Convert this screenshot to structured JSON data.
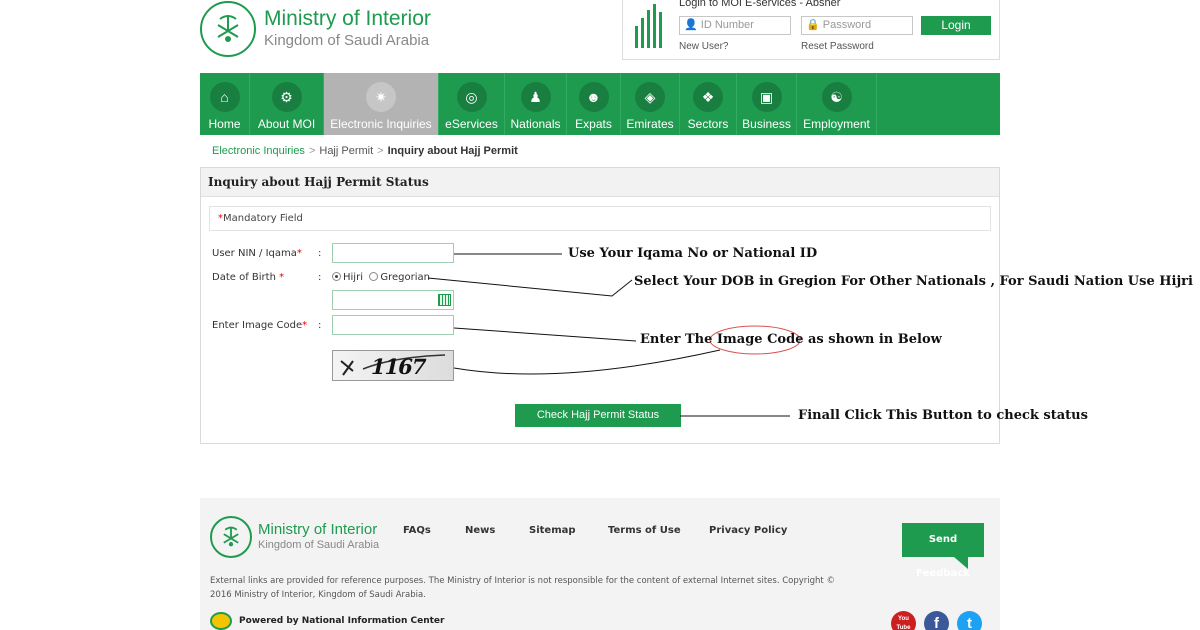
{
  "header": {
    "logo_title": "Ministry of Interior",
    "logo_subtitle": "Kingdom of Saudi Arabia"
  },
  "login": {
    "title": "Login to MOI E-services - Absher",
    "id_placeholder": "ID Number",
    "password_placeholder": "Password",
    "button": "Login",
    "new_user": "New User?",
    "reset_password": "Reset Password"
  },
  "nav": {
    "items": [
      {
        "label": "Home",
        "icon": "home-icon"
      },
      {
        "label": "About MOI",
        "icon": "emblem-icon"
      },
      {
        "label": "Electronic Inquiries",
        "icon": "fingerprint-icon",
        "active": true
      },
      {
        "label": "eServices",
        "icon": "globe-icon"
      },
      {
        "label": "Nationals",
        "icon": "person-icon"
      },
      {
        "label": "Expats",
        "icon": "group-icon"
      },
      {
        "label": "Emirates",
        "icon": "map-icon"
      },
      {
        "label": "Sectors",
        "icon": "network-icon"
      },
      {
        "label": "Business",
        "icon": "briefcase-icon"
      },
      {
        "label": "Employment",
        "icon": "team-icon"
      }
    ]
  },
  "breadcrumb": {
    "items": [
      "Electronic Inquiries",
      "Hajj Permit",
      "Inquiry about Hajj Permit"
    ]
  },
  "form": {
    "title": "Inquiry about Hajj Permit Status",
    "mandatory_note": "Mandatory Field",
    "nin_label": "User NIN / Iqama",
    "dob_label": "Date of Birth",
    "hijri": "Hijri",
    "gregorian": "Gregorian",
    "image_code_label": "Enter Image Code",
    "colon": ":",
    "required_mark": "*",
    "captcha_text": "1167",
    "submit": "Check Hajj Permit Status"
  },
  "annotations": {
    "nin": "Use Your Iqama No or National ID",
    "dob": "Select Your DOB in Gregion For Other Nationals , For Saudi Nation Use Hijri",
    "image_code": "Enter The Image Code as shown in Below",
    "button": "Finall Click This Button to check status"
  },
  "footer": {
    "logo_title": "Ministry of Interior",
    "logo_subtitle": "Kingdom of Saudi Arabia",
    "links": [
      "FAQs",
      "News",
      "Sitemap",
      "Terms of Use",
      "Privacy Policy"
    ],
    "feedback": "Send Feedback",
    "disclaimer": "External links are provided for reference purposes. The Ministry of Interior is not responsible for the content of external Internet sites. Copyright © 2016 Ministry of Interior, Kingdom of Saudi Arabia.",
    "powered": "Powered by National Information Center",
    "social": [
      {
        "name": "youtube",
        "label": "You Tube",
        "color": "#cc2020"
      },
      {
        "name": "facebook",
        "label": "f",
        "color": "#3b5998"
      },
      {
        "name": "twitter",
        "label": "t",
        "color": "#1da1f2"
      }
    ]
  },
  "colors": {
    "brand_green": "#1e9b4f",
    "nav_active": "#b3b3b3"
  }
}
